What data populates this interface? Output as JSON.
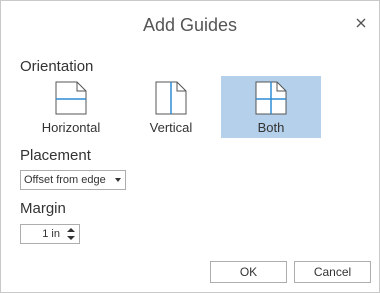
{
  "dialog": {
    "title": "Add Guides",
    "close_icon": "close-icon"
  },
  "orientation": {
    "label": "Orientation",
    "options": [
      {
        "label": "Horizontal",
        "icon": "horizontal-guide-icon",
        "selected": false
      },
      {
        "label": "Vertical",
        "icon": "vertical-guide-icon",
        "selected": false
      },
      {
        "label": "Both",
        "icon": "both-guides-icon",
        "selected": true
      }
    ],
    "selected_color": "#b4d0ea",
    "guide_color": "#2e8cd6"
  },
  "placement": {
    "label": "Placement",
    "value": "Offset from edge"
  },
  "margin": {
    "label": "Margin",
    "value": "1 in"
  },
  "buttons": {
    "ok": "OK",
    "cancel": "Cancel"
  }
}
